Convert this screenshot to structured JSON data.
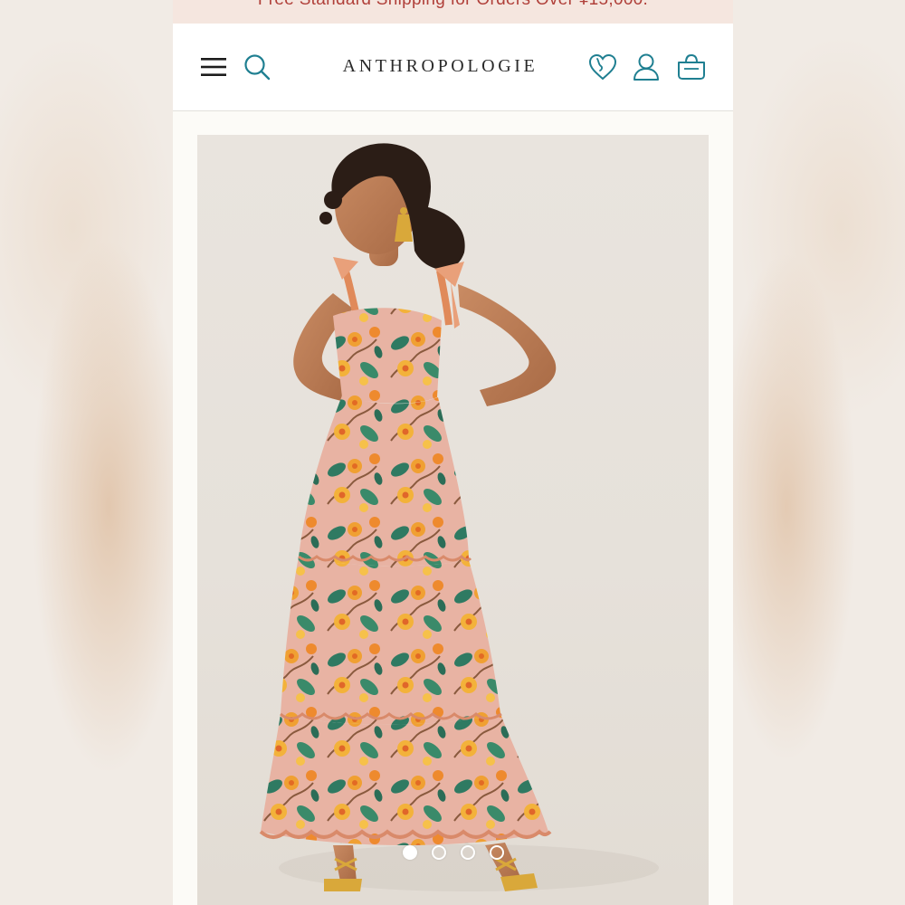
{
  "promo": {
    "text": "Free Standard Shipping for Orders Over ¥15,000."
  },
  "header": {
    "brand": "ANTHROPOLOGIE",
    "icons": [
      "menu-icon",
      "search-icon",
      "heart-icon",
      "account-icon",
      "bag-icon"
    ]
  },
  "product": {
    "image": {
      "subject": "model-in-floral-tiered-maxi-dress"
    },
    "carousel": {
      "total": 4,
      "active_index": 0
    }
  },
  "colors": {
    "accent_teal": "#1f7f91",
    "promo_text": "#b0403a",
    "promo_bg": "#f5e6df",
    "logo_text": "#2a2a2a"
  }
}
